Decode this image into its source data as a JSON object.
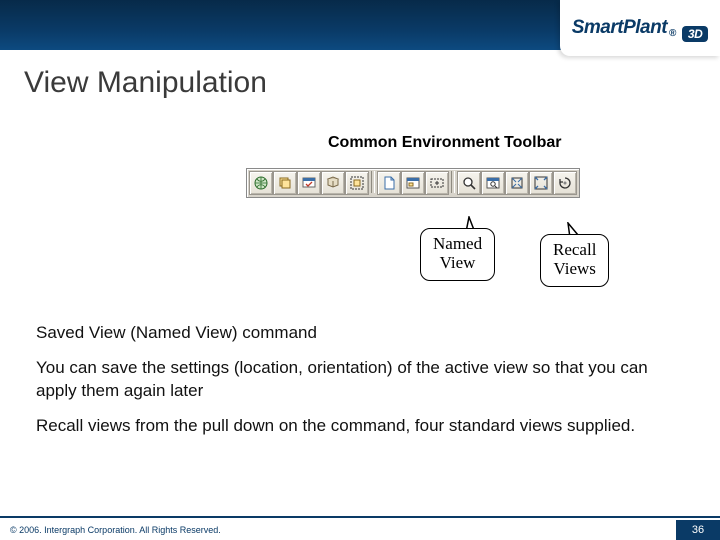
{
  "brand": {
    "name": "SmartPlant",
    "reg": "®",
    "suffix": "3D"
  },
  "title": "View Manipulation",
  "subtitle": "Common Environment Toolbar",
  "toolbar": {
    "icons": [
      "globe-icon",
      "layers-icon",
      "named-view-icon",
      "recall-views-icon",
      "fit-icon",
      "sheet-icon",
      "window-icon",
      "pan-icon",
      "zoom-icon",
      "zoom-in-icon",
      "zoom-out-icon",
      "extent-icon",
      "rotate-icon"
    ]
  },
  "callouts": {
    "named": {
      "l1": "Named",
      "l2": "View"
    },
    "recall": {
      "l1": "Recall",
      "l2": "Views"
    }
  },
  "body": {
    "p1": "Saved View (Named View) command",
    "p2": "You can save the settings (location, orientation) of the active view so that you can apply them again later",
    "p3": "Recall views from the pull down on the command, four standard views supplied."
  },
  "footer": {
    "copyright": "© 2006. Intergraph Corporation. All Rights Reserved.",
    "page": "36"
  }
}
